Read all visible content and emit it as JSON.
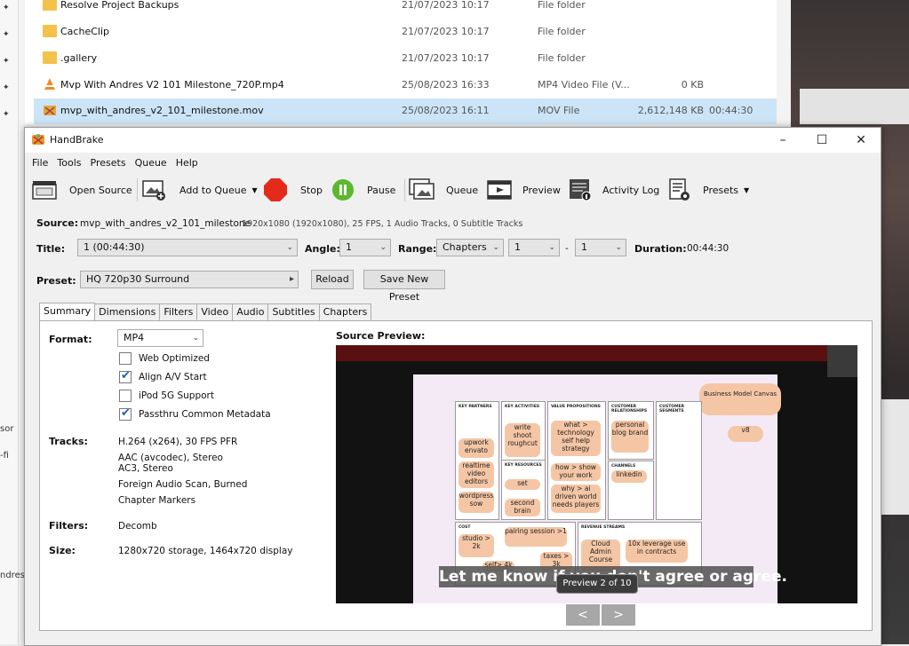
{
  "explorer": {
    "files": [
      {
        "name": "Resolve Project Backups",
        "date": "21/07/2023 10:17",
        "type": "File folder",
        "size": "",
        "duration": "",
        "kind": "folder"
      },
      {
        "name": "CacheClip",
        "date": "21/07/2023 10:17",
        "type": "File folder",
        "size": "",
        "duration": "",
        "kind": "folder"
      },
      {
        "name": ".gallery",
        "date": "21/07/2023 10:17",
        "type": "File folder",
        "size": "",
        "duration": "",
        "kind": "folder"
      },
      {
        "name": "Mvp With Andres V2 101 Milestone_720P.mp4",
        "date": "25/08/2023 16:33",
        "type": "MP4 Video File (V...",
        "size": "0 KB",
        "duration": "",
        "kind": "video"
      },
      {
        "name": "mvp_with_andres_v2_101_milestone.mov",
        "date": "25/08/2023 16:11",
        "type": "MOV File",
        "size": "2,612,148 KB",
        "duration": "00:44:30",
        "kind": "mov"
      }
    ],
    "side_fragments": [
      "sor",
      "-fi",
      "ndres"
    ]
  },
  "window": {
    "title": "HandBrake",
    "minimize": "–",
    "maximize": "☐",
    "close": "✕"
  },
  "menu": [
    "File",
    "Tools",
    "Presets",
    "Queue",
    "Help"
  ],
  "toolbar": {
    "open_source": "Open Source",
    "add_to_queue": "Add to Queue",
    "stop": "Stop",
    "pause": "Pause",
    "queue": "Queue",
    "preview": "Preview",
    "activity_log": "Activity Log",
    "presets": "Presets"
  },
  "source": {
    "label": "Source:",
    "name": "mvp_with_andres_v2_101_milestone",
    "info": "1920x1080 (1920x1080), 25 FPS, 1 Audio Tracks, 0 Subtitle Tracks"
  },
  "title_row": {
    "title_label": "Title:",
    "title_value": "1  (00:44:30)",
    "angle_label": "Angle:",
    "angle_value": "1",
    "range_label": "Range:",
    "range_value": "Chapters",
    "range_start": "1",
    "range_dash": "-",
    "range_end": "1",
    "duration_label": "Duration:",
    "duration_value": "00:44:30"
  },
  "preset": {
    "label": "Preset:",
    "value": "HQ 720p30 Surround",
    "reload": "Reload",
    "save_new": "Save New Preset"
  },
  "tabs": [
    "Summary",
    "Dimensions",
    "Filters",
    "Video",
    "Audio",
    "Subtitles",
    "Chapters"
  ],
  "summary": {
    "format_label": "Format:",
    "format_value": "MP4",
    "options": [
      {
        "label": "Web Optimized",
        "checked": false
      },
      {
        "label": "Align A/V Start",
        "checked": true
      },
      {
        "label": "iPod 5G Support",
        "checked": false
      },
      {
        "label": "Passthru Common Metadata",
        "checked": true
      }
    ],
    "tracks_label": "Tracks:",
    "tracks": [
      "H.264 (x264), 30 FPS PFR",
      "AAC (avcodec), Stereo",
      "AC3, Stereo",
      "Foreign Audio Scan, Burned",
      "Chapter Markers"
    ],
    "filters_label": "Filters:",
    "filters_value": "Decomb",
    "size_label": "Size:",
    "size_value": "1280x720 storage, 1464x720 display"
  },
  "preview": {
    "label": "Source Preview:",
    "subtitle": "Let me know if you don't agree or agree.",
    "counter": "Preview 2 of 10",
    "prev": "<",
    "next": ">",
    "canvas": {
      "title": "Business Model Canvas",
      "headers": [
        "KEY PARTNERS",
        "KEY ACTIVITIES",
        "VALUE PROPOSITIONS",
        "CUSTOMER RELATIONSHIPS",
        "CUSTOMER SEGMENTS",
        "KEY RESOURCES",
        "CHANNELS",
        "COST",
        "REVENUE STREAMS"
      ],
      "notes": [
        "upwork envato",
        "realtime video editors",
        "wordpress sow",
        "write shoot roughcut",
        "set",
        "second brain",
        "what > technology self help strategy",
        "how > show your work",
        "why > ai driven world needs players",
        "personal blog brand",
        "linkedin",
        "v8",
        "studio > 2k",
        "self> 4k",
        "pairing session >1",
        "taxes > 3k",
        "Cloud Admin Course",
        "10x leverage use in contracts"
      ]
    }
  }
}
